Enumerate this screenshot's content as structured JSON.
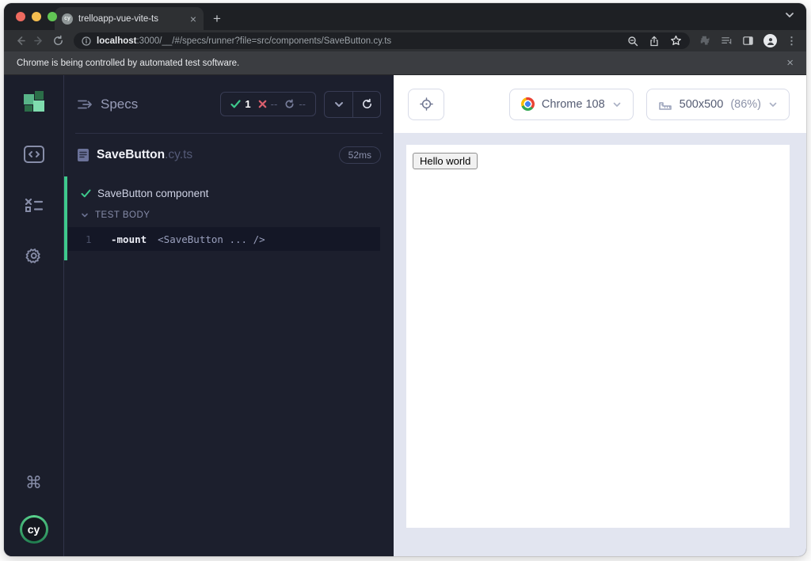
{
  "colors": {
    "accent_green": "#3ec98c",
    "fail_red": "#d95f6d",
    "sidebar_bg": "#1b1e2b",
    "specs_panel_bg": "#1c1f2d",
    "preview_bg": "#e2e5f0",
    "chrome_frame": "#1e2024"
  },
  "browser_chrome": {
    "tab": {
      "title": "trelloapp-vue-vite-ts",
      "close_glyph": "×",
      "favicon_text": "cy"
    },
    "new_tab_glyph": "+",
    "url": {
      "host": "localhost",
      "rest": ":3000/__/#/specs/runner?file=src/components/SaveButton.cy.ts"
    },
    "banner": {
      "text": "Chrome is being controlled by automated test software.",
      "close_glyph": "×"
    },
    "menu_glyph": "⋮"
  },
  "sidebar": {
    "command_glyph": "⌘",
    "logo_text": "cy"
  },
  "specs": {
    "title": "Specs",
    "stats": {
      "passed": "1",
      "failed": "--",
      "pending": "--"
    },
    "file": {
      "name": "SaveButton",
      "ext": ".cy.ts",
      "duration": "52ms"
    },
    "test": {
      "name": "SaveButton component",
      "section": "TEST BODY",
      "line": "1",
      "command": "-mount",
      "args": "<SaveButton ... />"
    }
  },
  "preview": {
    "browser": "Chrome 108",
    "viewport": "500x500",
    "zoom": "(86%)",
    "content_button": "Hello world"
  }
}
